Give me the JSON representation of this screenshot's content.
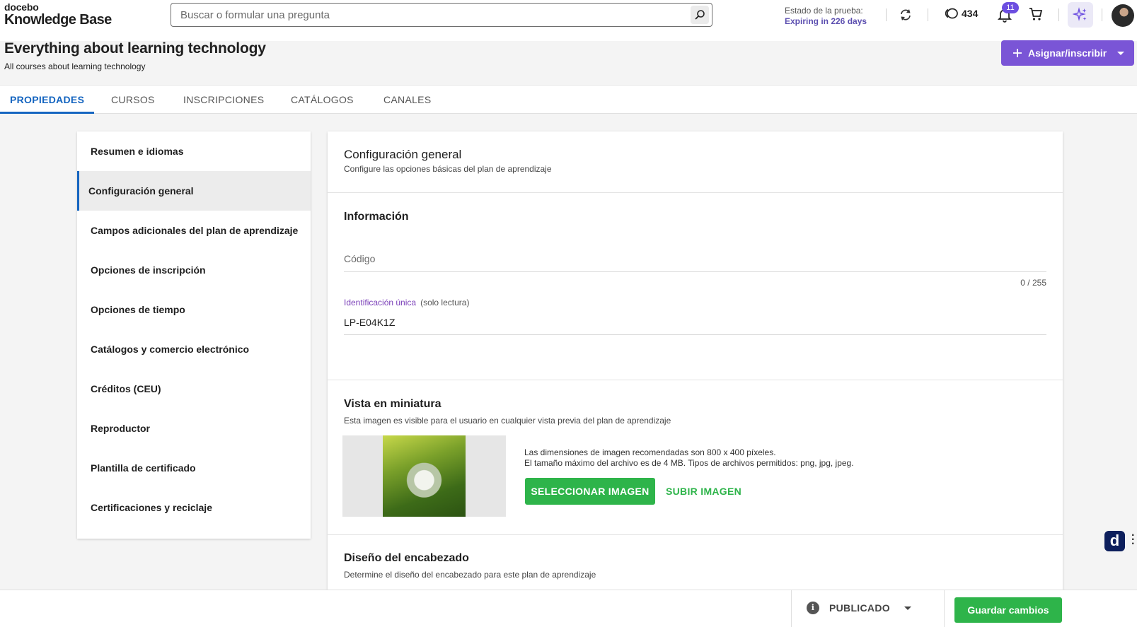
{
  "brand": {
    "small": "docebo",
    "big": "Knowledge Base"
  },
  "search": {
    "placeholder": "Buscar o formular una pregunta"
  },
  "trial": {
    "label": "Estado de la prueba:",
    "value": "Expiring in 226 days"
  },
  "credits": {
    "value": "434"
  },
  "notifications": {
    "count": "11"
  },
  "page": {
    "title": "Everything about learning technology",
    "subtitle": "All courses about learning technology",
    "assign_label": "Asignar/inscribir"
  },
  "tabs": [
    {
      "label": "PROPIEDADES",
      "active": true
    },
    {
      "label": "CURSOS"
    },
    {
      "label": "INSCRIPCIONES"
    },
    {
      "label": "CATÁLOGOS"
    },
    {
      "label": "CANALES"
    }
  ],
  "sidebar": {
    "items": [
      {
        "label": "Resumen e idiomas"
      },
      {
        "label": "Configuración general",
        "active": true
      },
      {
        "label": "Campos adicionales del plan de aprendizaje"
      },
      {
        "label": "Opciones de inscripción"
      },
      {
        "label": "Opciones de tiempo"
      },
      {
        "label": "Catálogos y comercio electrónico"
      },
      {
        "label": "Créditos (CEU)"
      },
      {
        "label": "Reproductor"
      },
      {
        "label": "Plantilla de certificado"
      },
      {
        "label": "Certificaciones y reciclaje"
      }
    ]
  },
  "general": {
    "title": "Configuración general",
    "description": "Configure las opciones básicas del plan de aprendizaje"
  },
  "info": {
    "title": "Información",
    "code_label": "Código",
    "code_counter": "0 / 255",
    "uid_label": "Identificación única",
    "uid_note": "(solo lectura)",
    "uid_value": "LP-E04K1Z"
  },
  "thumbnail": {
    "title": "Vista en miniatura",
    "description": "Esta imagen es visible para el usuario en cualquier vista previa del plan de aprendizaje",
    "info_line1": "Las dimensiones de imagen recomendadas son 800 x 400 píxeles.",
    "info_line2": "El tamaño máximo del archivo es de 4 MB. Tipos de archivos permitidos: png, jpg, jpeg.",
    "select_label": "SELECCIONAR IMAGEN",
    "upload_label": "SUBIR IMAGEN"
  },
  "header_design": {
    "title": "Diseño del encabezado",
    "description": "Determine el diseño del encabezado para este plan de aprendizaje"
  },
  "footer": {
    "status_label": "PUBLICADO",
    "save_label": "Guardar cambios"
  },
  "widget": {
    "letter": "d"
  },
  "colors": {
    "accent_purple": "#7a55d6",
    "tab_active": "#1565c0",
    "green": "#2eb44a",
    "trial_purple": "#5c4fb0"
  }
}
